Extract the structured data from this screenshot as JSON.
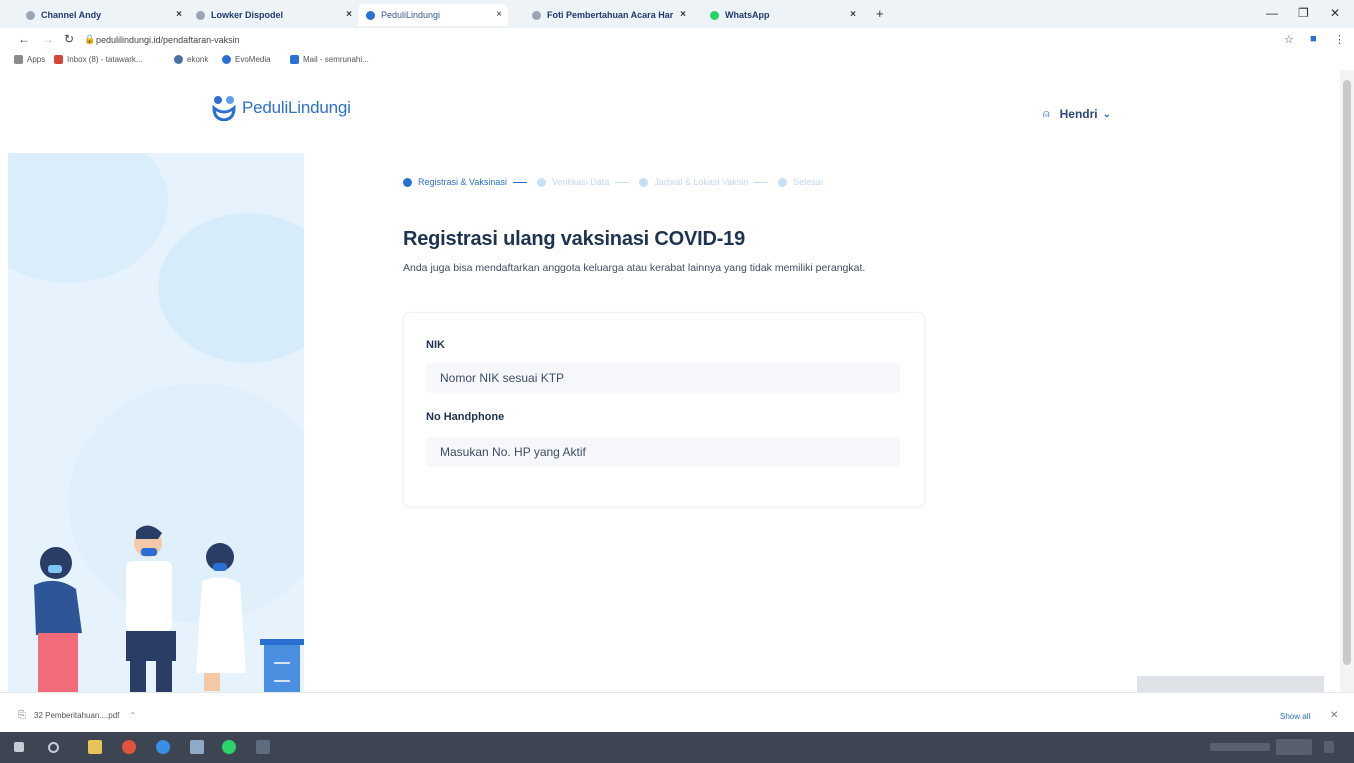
{
  "browser": {
    "tabs": [
      {
        "label": "Channel Andy",
        "active": false,
        "favicon_color": "#9aa6b6"
      },
      {
        "label": "Lowker Dispodel",
        "active": false,
        "favicon_color": "#9aa6b6"
      },
      {
        "label": "PeduliLindungi",
        "active": true,
        "favicon_color": "#2c6fd4"
      },
      {
        "label": "Foti Pembertahuan Acara Har",
        "active": false,
        "favicon_color": "#9aa6b6"
      },
      {
        "label": "WhatsApp",
        "active": false,
        "favicon_color": "#25d366"
      }
    ],
    "close_glyph": "×",
    "new_tab_glyph": "+",
    "address": "pedulilindungi.id/pendaftaran-vaksin",
    "bookmarks": [
      {
        "label": "Apps",
        "icon_color": "#8a8a8a"
      },
      {
        "label": "Inbox (8) - tatawark...",
        "icon_color": "#d44638"
      },
      {
        "label": "ekonk",
        "icon_color": "#4a6fa5"
      },
      {
        "label": "EvoMedia",
        "icon_color": "#2c6fd4"
      },
      {
        "label": "Mail - semrunahi...",
        "icon_color": "#2c6fd4"
      }
    ]
  },
  "site": {
    "logo_text": "PeduliLindungi",
    "user_name": "Hendri",
    "user_icon": "user-icon",
    "brand_color": "#2c6fd4"
  },
  "stepper": {
    "steps": [
      {
        "label": "Registrasi & Vaksinasi",
        "active": true
      },
      {
        "label": "Verifikasi Data",
        "active": false
      },
      {
        "label": "Jadwal & Lokasi Vaksin",
        "active": false
      },
      {
        "label": "Selesai",
        "active": false
      }
    ]
  },
  "form": {
    "title": "Registrasi ulang vaksinasi COVID-19",
    "subtitle": "Anda juga bisa mendaftarkan anggota keluarga atau kerabat lainnya yang tidak memiliki perangkat.",
    "fields": [
      {
        "label": "NIK",
        "placeholder": "Nomor NIK sesuai KTP",
        "value": ""
      },
      {
        "label": "No Handphone",
        "placeholder": "Masukan No. HP yang Aktif",
        "value": ""
      }
    ]
  },
  "downloads": {
    "file": "32 Pemberitahuan....pdf",
    "show_all": "Show all"
  }
}
